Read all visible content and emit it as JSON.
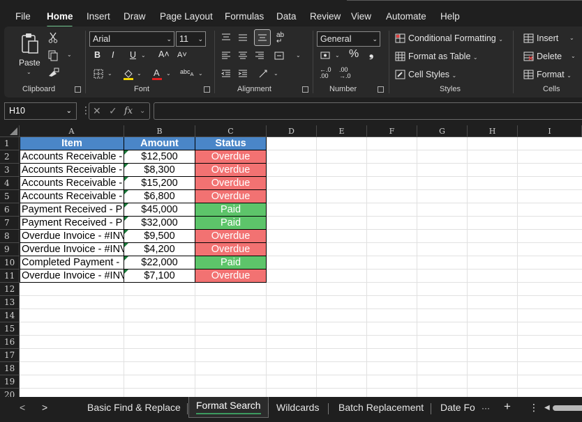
{
  "menu": {
    "tabs": [
      "File",
      "Home",
      "Insert",
      "Draw",
      "Page Layout",
      "Formulas",
      "Data",
      "Review",
      "View",
      "Automate",
      "Help"
    ],
    "active": "Home"
  },
  "ribbon": {
    "clipboard": {
      "label": "Clipboard",
      "paste": "Paste"
    },
    "font": {
      "label": "Font",
      "name": "Arial",
      "size": "11",
      "bold": "B",
      "italic": "I",
      "underline": "U"
    },
    "alignment": {
      "label": "Alignment"
    },
    "number": {
      "label": "Number",
      "format": "General",
      "percent": "%",
      "comma": "❟",
      "inc_decimal": ".00",
      "dec_decimal": ".00"
    },
    "styles": {
      "label": "Styles",
      "conditional": "Conditional Formatting",
      "table": "Format as Table",
      "cell_styles": "Cell Styles"
    },
    "cells": {
      "label": "Cells",
      "insert": "Insert",
      "delete": "Delete",
      "format": "Format"
    }
  },
  "formula_bar": {
    "name_box": "H10",
    "fx": "fx",
    "value": ""
  },
  "grid": {
    "columns": [
      "A",
      "B",
      "C",
      "D",
      "E",
      "F",
      "G",
      "H",
      "I"
    ],
    "rows": [
      "1",
      "2",
      "3",
      "4",
      "5",
      "6",
      "7",
      "8",
      "9",
      "10",
      "11",
      "12",
      "13",
      "14",
      "15",
      "16",
      "17",
      "18",
      "19",
      "20"
    ],
    "headers": [
      "Item",
      "Amount",
      "Status"
    ],
    "data": [
      {
        "item": "Accounts Receivable - ",
        "amount": "$12,500",
        "status": "Overdue"
      },
      {
        "item": "Accounts Receivable - ",
        "amount": "$8,300",
        "status": "Overdue"
      },
      {
        "item": "Accounts Receivable - ",
        "amount": "$15,200",
        "status": "Overdue"
      },
      {
        "item": "Accounts Receivable - ",
        "amount": "$6,800",
        "status": "Overdue"
      },
      {
        "item": "Payment Received - P",
        "amount": "$45,000",
        "status": "Paid"
      },
      {
        "item": "Payment Received - P",
        "amount": "$32,000",
        "status": "Paid"
      },
      {
        "item": "Overdue Invoice - #INV",
        "amount": "$9,500",
        "status": "Overdue"
      },
      {
        "item": "Overdue Invoice - #INV",
        "amount": "$4,200",
        "status": "Overdue"
      },
      {
        "item": "Completed Payment - ",
        "amount": "$22,000",
        "status": "Paid"
      },
      {
        "item": "Overdue Invoice - #INV",
        "amount": "$7,100",
        "status": "Overdue"
      }
    ],
    "colors": {
      "header": "#4a86c8",
      "overdue": "#f27272",
      "paid": "#5dc46a"
    }
  },
  "sheets": {
    "tabs": [
      "Basic Find & Replace",
      "Format Search",
      "Wildcards",
      "Batch Replacement",
      "Date Fo"
    ],
    "active": "Format Search",
    "more": "···",
    "add": "+",
    "menu": "⋮"
  }
}
